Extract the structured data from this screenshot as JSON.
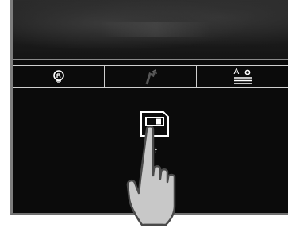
{
  "toolbar": {
    "buttons": [
      {
        "icon": "lightbulb-icon"
      },
      {
        "icon": "motion-sensor-icon"
      },
      {
        "icon": "text-settings-icon",
        "label": "A"
      }
    ]
  },
  "main": {
    "icon": "save-memory-card-icon",
    "pins": [
      "ɟ",
      "ɟ"
    ]
  },
  "gesture": {
    "icon": "tap-hand-icon"
  },
  "colors": {
    "background": "#0b0b0b",
    "foreground": "#ffffff",
    "hand_fill": "#c8c8c8",
    "hand_stroke": "#4a4a4a"
  }
}
